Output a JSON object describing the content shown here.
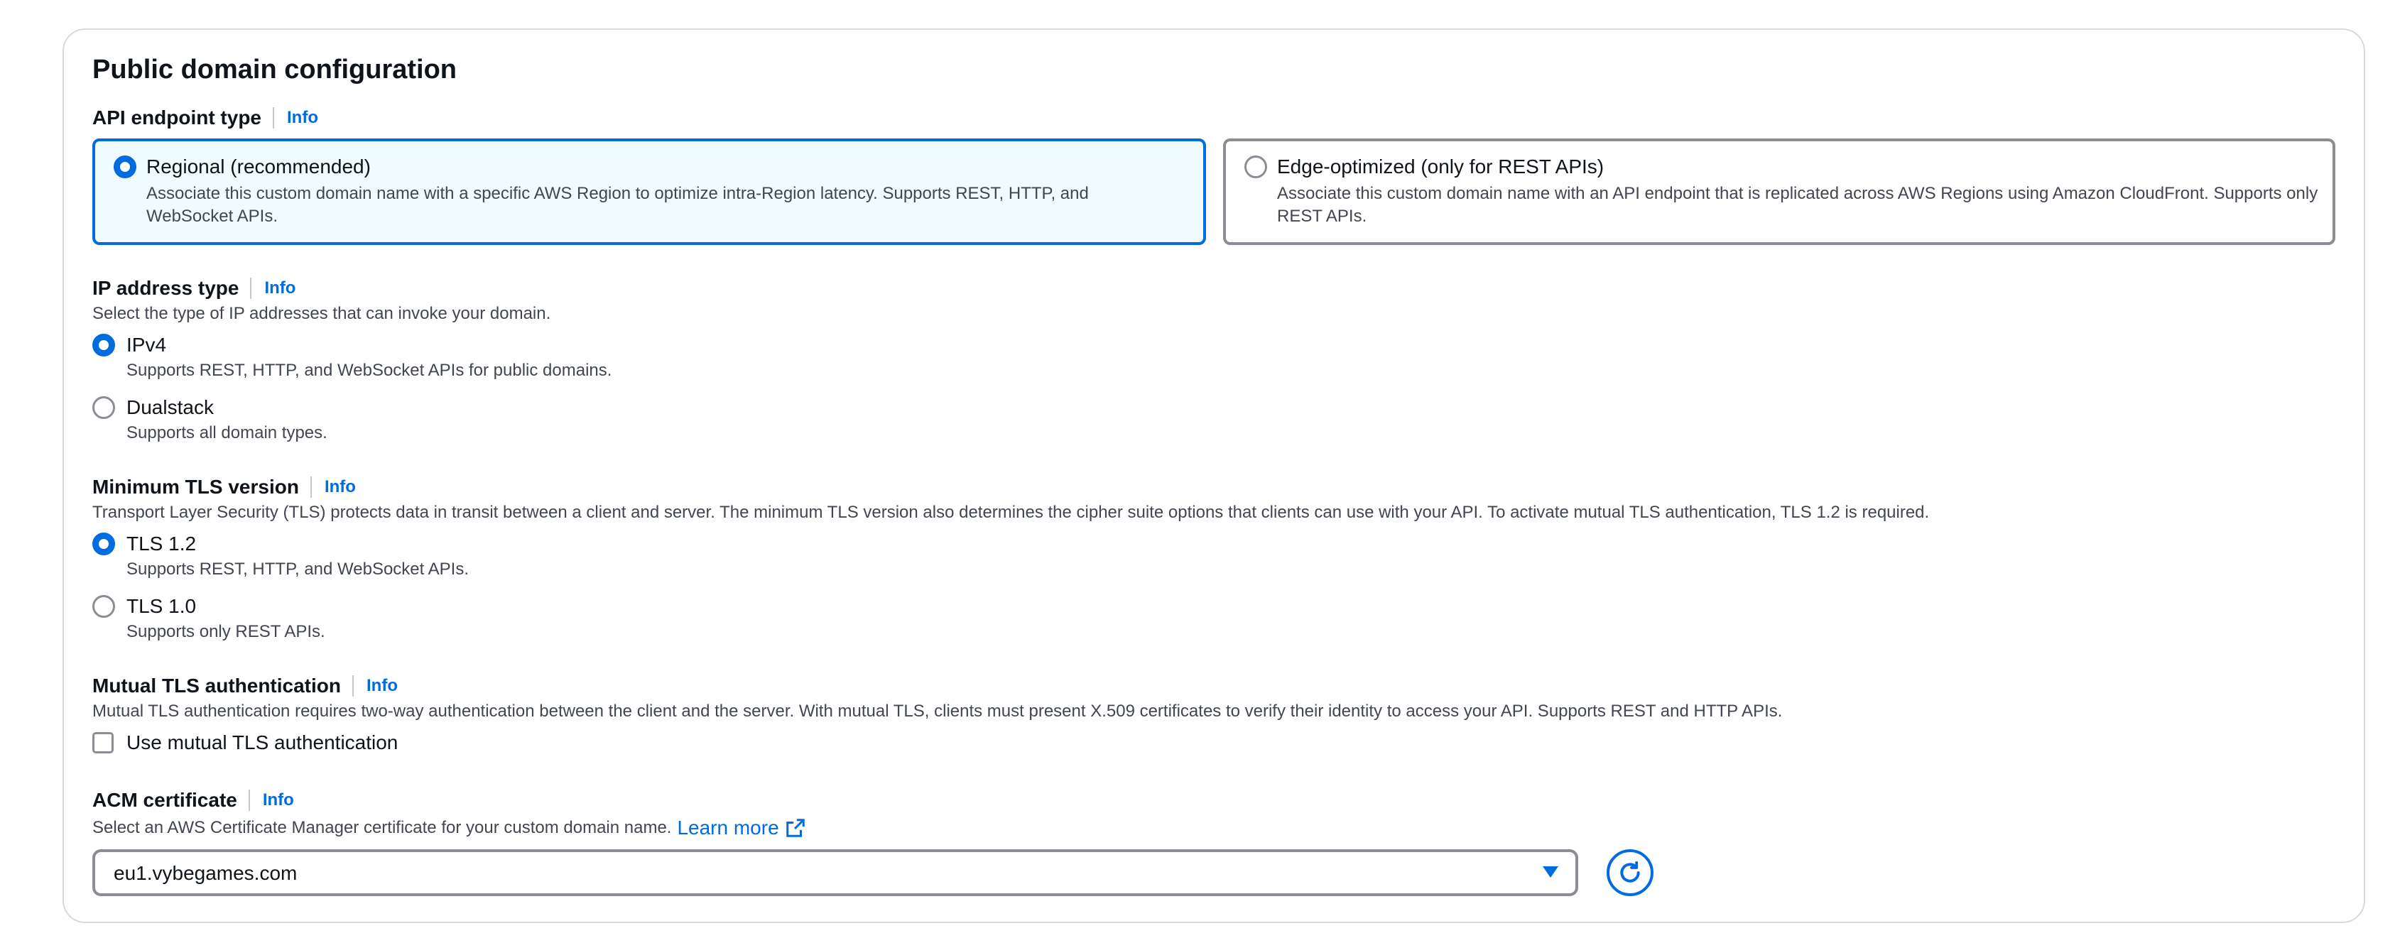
{
  "panel": {
    "title": "Public domain configuration"
  },
  "info_label": "Info",
  "endpoint_type": {
    "label": "API endpoint type",
    "options": [
      {
        "title": "Regional (recommended)",
        "desc": "Associate this custom domain name with a specific AWS Region to optimize intra-Region latency. Supports REST, HTTP, and WebSocket APIs.",
        "selected": true
      },
      {
        "title": "Edge-optimized (only for REST APIs)",
        "desc": "Associate this custom domain name with an API endpoint that is replicated across AWS Regions using Amazon CloudFront. Supports only REST APIs.",
        "selected": false
      }
    ]
  },
  "ip_type": {
    "label": "IP address type",
    "desc": "Select the type of IP addresses that can invoke your domain.",
    "options": [
      {
        "label": "IPv4",
        "desc": "Supports REST, HTTP, and WebSocket APIs for public domains.",
        "checked": true
      },
      {
        "label": "Dualstack",
        "desc": "Supports all domain types.",
        "checked": false
      }
    ]
  },
  "tls": {
    "label": "Minimum TLS version",
    "desc": "Transport Layer Security (TLS) protects data in transit between a client and server. The minimum TLS version also determines the cipher suite options that clients can use with your API. To activate mutual TLS authentication, TLS 1.2 is required.",
    "options": [
      {
        "label": "TLS 1.2",
        "desc": "Supports REST, HTTP, and WebSocket APIs.",
        "checked": true
      },
      {
        "label": "TLS 1.0",
        "desc": "Supports only REST APIs.",
        "checked": false
      }
    ]
  },
  "mtls": {
    "label": "Mutual TLS authentication",
    "desc": "Mutual TLS authentication requires two-way authentication between the client and the server. With mutual TLS, clients must present X.509 certificates to verify their identity to access your API. Supports REST and HTTP APIs.",
    "checkbox_label": "Use mutual TLS authentication",
    "checked": false
  },
  "acm": {
    "label": "ACM certificate",
    "desc": "Select an AWS Certificate Manager certificate for your custom domain name.",
    "learn_more": "Learn more",
    "selected_value": "eu1.vybegames.com"
  },
  "colors": {
    "accent": "#006ce0",
    "border": "#8c8c94",
    "selected_bg": "#f0fbff"
  },
  "icons": {
    "external_link": "external-link-icon",
    "refresh": "refresh-icon",
    "dropdown": "caret-down-icon"
  }
}
